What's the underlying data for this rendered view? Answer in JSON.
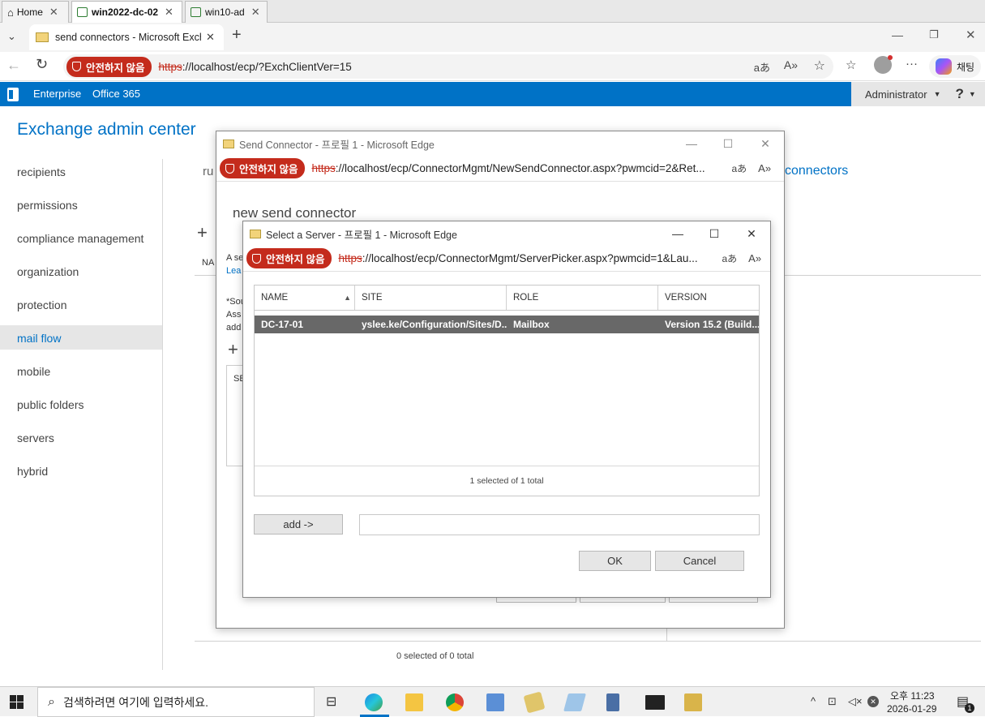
{
  "vm_tabs": [
    {
      "label": "Home"
    },
    {
      "label": "win2022-dc-02"
    },
    {
      "label": "win10-ad"
    }
  ],
  "browser": {
    "tab_title": "send connectors - Microsoft Exch",
    "unsafe_label": "안전하지 않음",
    "url_scheme": "https",
    "url_rest": "://localhost/ecp/?ExchClientVer=15",
    "copilot_label": "채팅"
  },
  "eac": {
    "brand_enterprise": "Enterprise",
    "brand_o365": "Office 365",
    "admin_user": "Administrator",
    "help_label": "?",
    "title": "Exchange admin center",
    "nav": [
      "recipients",
      "permissions",
      "compliance management",
      "organization",
      "protection",
      "mail flow",
      "mobile",
      "public folders",
      "servers",
      "hybrid"
    ],
    "active_nav": "mail flow",
    "tab_rules_partial": "ru",
    "tab_send_connectors": "connectors",
    "list_col_partial": "NA",
    "footer_count": "0 selected of 0 total"
  },
  "send_connector_window": {
    "title": "Send Connector - 프로필 1 - Microsoft Edge",
    "url_rest": "://localhost/ecp/ConnectorMgmt/NewSendConnector.aspx?pwmcid=2&Ret...",
    "heading": "new send connector",
    "text_a": "A se",
    "text_lea": "Lea",
    "text_sou": "*Sou",
    "text_ass": "Ass",
    "text_add": "add",
    "col_se": "SE"
  },
  "server_picker": {
    "title": "Select a Server - 프로필 1 - Microsoft Edge",
    "url_rest": "://localhost/ecp/ConnectorMgmt/ServerPicker.aspx?pwmcid=1&Lau...",
    "columns": [
      "NAME",
      "SITE",
      "ROLE",
      "VERSION"
    ],
    "rows": [
      {
        "name": "DC-17-01",
        "site": "yslee.ke/Configuration/Sites/D...",
        "role": "Mailbox",
        "version": "Version 15.2 (Build..."
      }
    ],
    "count": "1 selected of 1 total",
    "add_button": "add ->",
    "add_value": "",
    "ok_button": "OK",
    "cancel_button": "Cancel"
  },
  "taskbar": {
    "search_placeholder": "검색하려면 여기에 입력하세요.",
    "time": "오후 11:23",
    "date": "2026-01-29",
    "notif_count": "1"
  },
  "colors": {
    "accent": "#0072c6",
    "unsafe": "#c42b1c",
    "selected_row": "#686868"
  }
}
